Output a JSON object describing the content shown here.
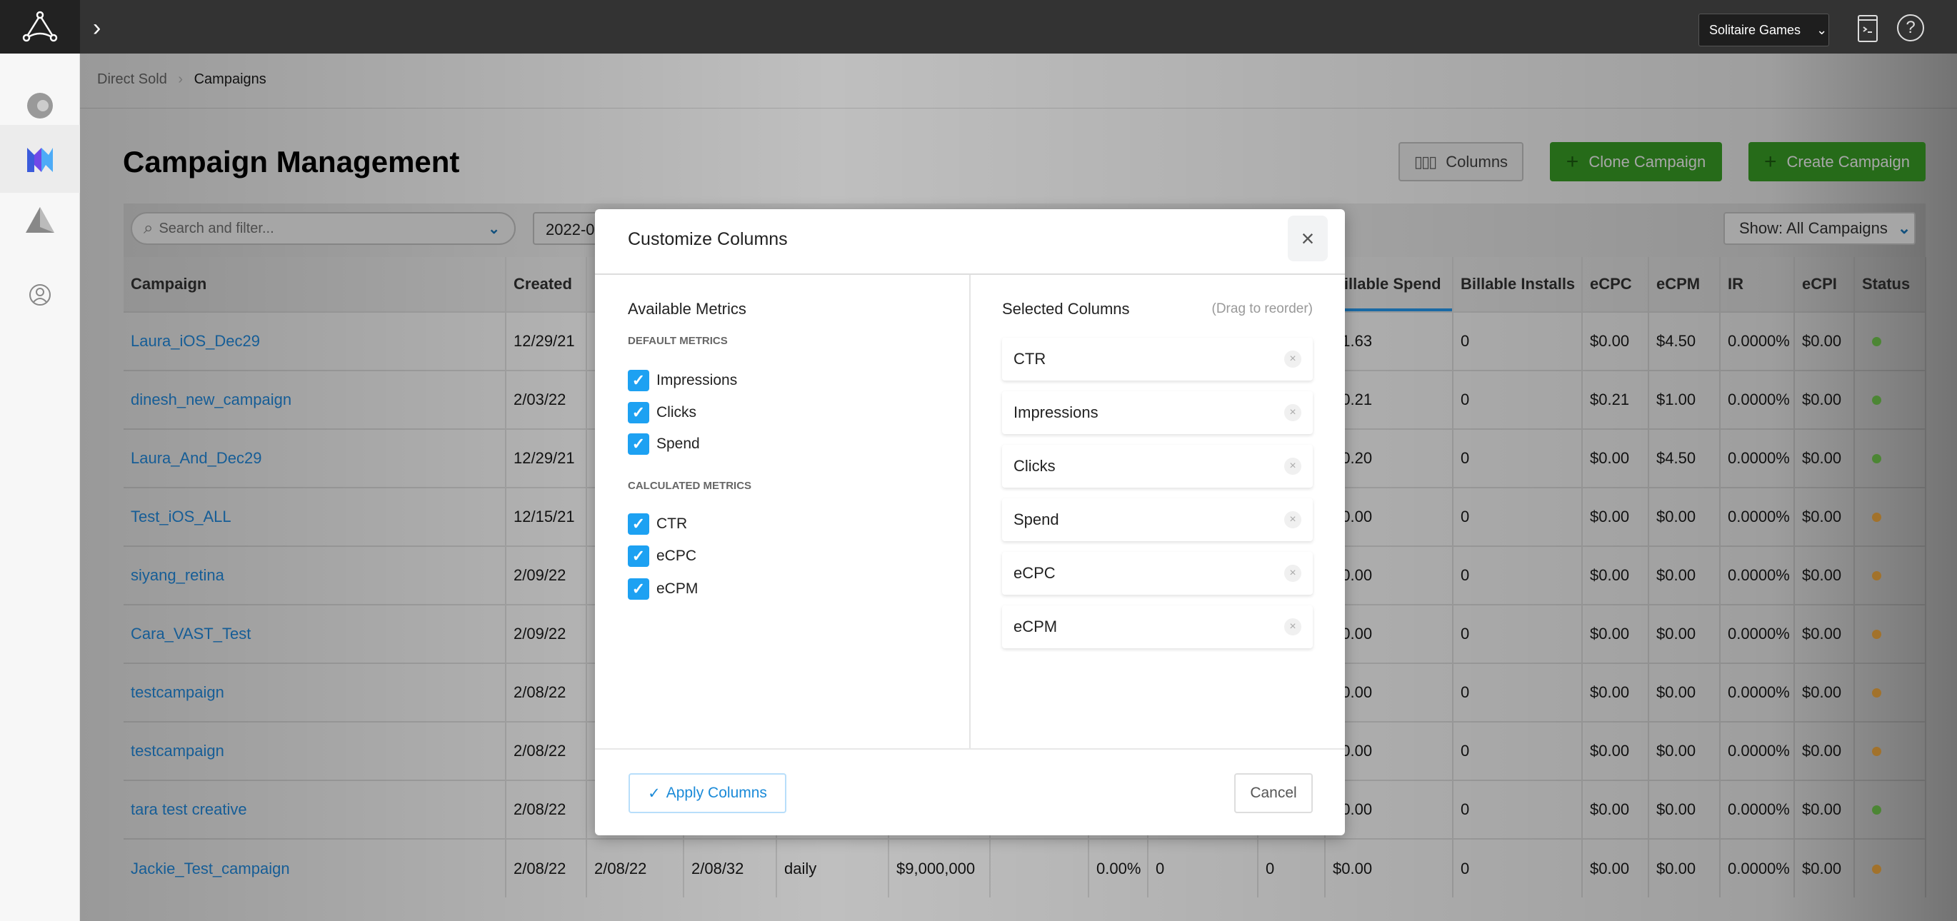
{
  "topbar": {
    "account": "Solitaire Games"
  },
  "breadcrumb": {
    "parent": "Direct Sold",
    "current": "Campaigns"
  },
  "page": {
    "title": "Campaign Management"
  },
  "actions": {
    "columns": "Columns",
    "clone": "Clone Campaign",
    "create": "Create Campaign"
  },
  "toolbar": {
    "search_placeholder": "Search and filter...",
    "date": "2022-0",
    "show": "Show: All Campaigns"
  },
  "table": {
    "headers": [
      "Campaign",
      "Created",
      "",
      "",
      "",
      "",
      "",
      "",
      "",
      "",
      "Billable Spend",
      "Billable Installs",
      "eCPC",
      "eCPM",
      "IR",
      "eCPI",
      "Status"
    ],
    "rows": [
      [
        "Laura_iOS_Dec29",
        "12/29/21",
        "",
        "",
        "",
        "",
        "",
        "",
        "",
        "",
        "$1.63",
        "0",
        "$0.00",
        "$4.50",
        "0.0000%",
        "$0.00",
        "active"
      ],
      [
        "dinesh_new_campaign",
        "2/03/22",
        "",
        "",
        "",
        "",
        "",
        "",
        "",
        "",
        "$0.21",
        "0",
        "$0.21",
        "$1.00",
        "0.0000%",
        "$0.00",
        "active"
      ],
      [
        "Laura_And_Dec29",
        "12/29/21",
        "",
        "",
        "",
        "",
        "",
        "",
        "",
        "",
        "$0.20",
        "0",
        "$0.00",
        "$4.50",
        "0.0000%",
        "$0.00",
        "active"
      ],
      [
        "Test_iOS_ALL",
        "12/15/21",
        "",
        "",
        "",
        "",
        "",
        "",
        "",
        "",
        "$0.00",
        "0",
        "$0.00",
        "$0.00",
        "0.0000%",
        "$0.00",
        "pending"
      ],
      [
        "siyang_retina",
        "2/09/22",
        "",
        "",
        "",
        "",
        "",
        "",
        "",
        "",
        "$0.00",
        "0",
        "$0.00",
        "$0.00",
        "0.0000%",
        "$0.00",
        "pending"
      ],
      [
        "Cara_VAST_Test",
        "2/09/22",
        "",
        "",
        "",
        "",
        "",
        "",
        "",
        "",
        "$0.00",
        "0",
        "$0.00",
        "$0.00",
        "0.0000%",
        "$0.00",
        "pending"
      ],
      [
        "testcampaign",
        "2/08/22",
        "",
        "",
        "",
        "",
        "",
        "",
        "",
        "",
        "$0.00",
        "0",
        "$0.00",
        "$0.00",
        "0.0000%",
        "$0.00",
        "pending"
      ],
      [
        "testcampaign",
        "2/08/22",
        "",
        "",
        "",
        "",
        "",
        "",
        "",
        "",
        "$0.00",
        "0",
        "$0.00",
        "$0.00",
        "0.0000%",
        "$0.00",
        "pending"
      ],
      [
        "tara test creative",
        "2/08/22",
        "",
        "",
        "",
        "",
        "",
        "",
        "",
        "",
        "$0.00",
        "0",
        "$0.00",
        "$0.00",
        "0.0000%",
        "$0.00",
        "active"
      ],
      [
        "Jackie_Test_campaign",
        "2/08/22",
        "2/08/22",
        "2/08/32",
        "daily",
        "$9,000,000",
        "",
        "0.00%",
        "0",
        "0",
        "$0.00",
        "0",
        "$0.00",
        "$0.00",
        "0.0000%",
        "$0.00",
        "pending"
      ]
    ],
    "status_colors": {
      "active": "#6cc04a",
      "pending": "#e8a33d"
    }
  },
  "modal": {
    "title": "Customize Columns",
    "available_title": "Available Metrics",
    "default_caption": "DEFAULT METRICS",
    "default_metrics": [
      {
        "label": "Impressions",
        "checked": true
      },
      {
        "label": "Clicks",
        "checked": true
      },
      {
        "label": "Spend",
        "checked": true
      }
    ],
    "calculated_caption": "CALCULATED METRICS",
    "calculated_metrics": [
      {
        "label": "CTR",
        "checked": true
      },
      {
        "label": "eCPC",
        "checked": true
      },
      {
        "label": "eCPM",
        "checked": true
      }
    ],
    "selected_title": "Selected Columns",
    "drag_hint": "(Drag to reorder)",
    "selected_columns": [
      "CTR",
      "Impressions",
      "Clicks",
      "Spend",
      "eCPC",
      "eCPM"
    ],
    "apply": "Apply Columns",
    "cancel": "Cancel"
  },
  "colors": {
    "accent": "#1da1f2",
    "green_button": "#3aa526",
    "link": "#1a6fb5"
  }
}
